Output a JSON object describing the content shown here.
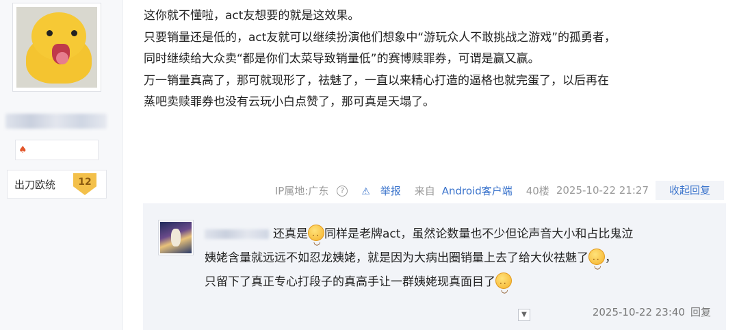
{
  "user": {
    "avatar": "yellow-duck-avatar",
    "title_label": "出刀欧统",
    "level": "12"
  },
  "post": {
    "lines": [
      "这你就不懂啦，act友想要的就是这效果。",
      "只要销量还是低的，act友就可以继续扮演他们想象中“游玩众人不敢挑战之游戏”的孤勇者，",
      "同时继续给大众卖“都是你们太菜导致销量低”的赛博赎罪券，可谓是赢又赢。",
      "万一销量真高了，那可就现形了，祛魅了，一直以来精心打造的逼格也就完蛋了，以后再在",
      "蒸吧卖赎罪券也没有云玩小白点赞了，那可真是天塌了。"
    ],
    "footer": {
      "ip": "IP属地:广东",
      "help_icon": "?",
      "report": "举报",
      "client_prefix": "来自",
      "client": "Android客户端",
      "floor": "40楼",
      "time": "2025-10-22 21:27",
      "collapse": "收起回复"
    }
  },
  "reply": {
    "line1_a": "还真是",
    "line1_b": "同样是老牌act，虽然论数量也不少但论声音大小和占比鬼泣",
    "line2": "姨姥含量就远远不如忍龙姨姥，就是因为大病出圈销量上去了给大伙祛魅了",
    "line2_end": "，",
    "line3": "只留下了真正专心打段子的真高手让一群姨姥现真面目了",
    "time": "2025-10-22 23:40",
    "reply_label": "回复"
  },
  "colors": {
    "link": "#3b74cc",
    "muted": "#999999",
    "reply_bg": "#f2f4f8"
  }
}
